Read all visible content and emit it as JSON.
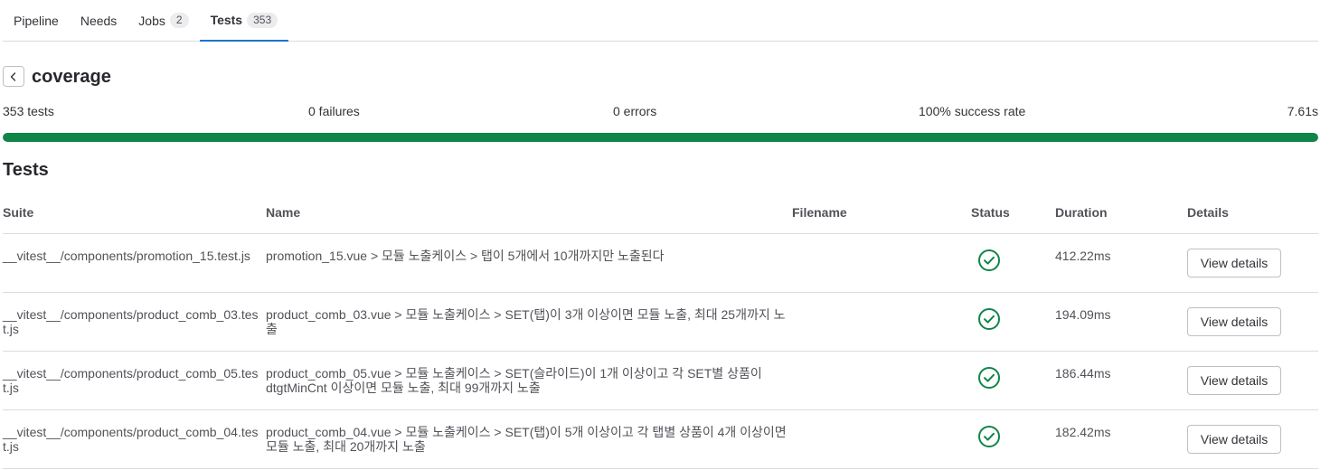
{
  "tabs": [
    {
      "label": "Pipeline",
      "count": null
    },
    {
      "label": "Needs",
      "count": null
    },
    {
      "label": "Jobs",
      "count": "2"
    },
    {
      "label": "Tests",
      "count": "353",
      "active": true
    }
  ],
  "suite": {
    "back_icon": "chevron-left-icon",
    "title": "coverage"
  },
  "summary": {
    "tests": "353 tests",
    "failures": "0 failures",
    "errors": "0 errors",
    "success_rate": "100% success rate",
    "duration": "7.61s",
    "success_fraction": 1.0
  },
  "section_title": "Tests",
  "table": {
    "headers": {
      "suite": "Suite",
      "name": "Name",
      "filename": "Filename",
      "status": "Status",
      "duration": "Duration",
      "details": "Details"
    },
    "rows": [
      {
        "suite": "__vitest__/components/promotion_15.test.js",
        "name": "promotion_15.vue > 모듈 노출케이스 > 탭이 5개에서 10개까지만 노출된다",
        "filename": "",
        "status": "success",
        "duration": "412.22ms",
        "details_label": "View details"
      },
      {
        "suite": "__vitest__/components/product_comb_03.test.js",
        "name": "product_comb_03.vue > 모듈 노출케이스 > SET(탭)이 3개 이상이면 모듈 노출, 최대 25개까지 노출",
        "filename": "",
        "status": "success",
        "duration": "194.09ms",
        "details_label": "View details"
      },
      {
        "suite": "__vitest__/components/product_comb_05.test.js",
        "name": "product_comb_05.vue > 모듈 노출케이스 > SET(슬라이드)이 1개 이상이고 각 SET별 상품이 dtgtMinCnt 이상이면 모듈 노출, 최대 99개까지 노출",
        "filename": "",
        "status": "success",
        "duration": "186.44ms",
        "details_label": "View details"
      },
      {
        "suite": "__vitest__/components/product_comb_04.test.js",
        "name": "product_comb_04.vue > 모듈 노출케이스 > SET(탭)이 5개 이상이고 각 탭별 상품이 4개 이상이면 모듈 노출, 최대 20개까지 노출",
        "filename": "",
        "status": "success",
        "duration": "182.42ms",
        "details_label": "View details"
      }
    ]
  },
  "colors": {
    "accent": "#1f75cb",
    "success": "#108548"
  }
}
